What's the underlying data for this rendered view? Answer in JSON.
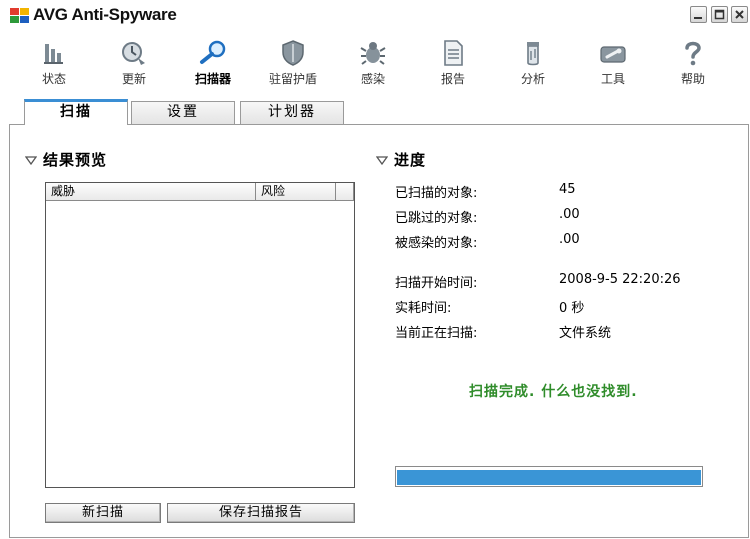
{
  "window": {
    "title": "AVG Anti-Spyware",
    "controls": [
      "minimize-icon",
      "maximize-icon",
      "close-icon"
    ]
  },
  "toolbar": [
    {
      "label": "状态",
      "icon": "status-bars-icon"
    },
    {
      "label": "更新",
      "icon": "update-clock-icon"
    },
    {
      "label": "扫描器",
      "icon": "scanner-magnifier-icon",
      "active": true
    },
    {
      "label": "驻留护盾",
      "icon": "shield-icon"
    },
    {
      "label": "感染",
      "icon": "bug-icon"
    },
    {
      "label": "报告",
      "icon": "report-document-icon"
    },
    {
      "label": "分析",
      "icon": "analysis-jar-icon"
    },
    {
      "label": "工具",
      "icon": "tools-wrench-icon"
    },
    {
      "label": "帮助",
      "icon": "help-question-icon"
    }
  ],
  "tabs": [
    {
      "label": "扫描",
      "active": true
    },
    {
      "label": "设置"
    },
    {
      "label": "计划器"
    }
  ],
  "results": {
    "title": "结果预览",
    "columns": [
      "威胁",
      "风险"
    ]
  },
  "buttons": {
    "new_scan": "新扫描",
    "save_report": "保存扫描报告"
  },
  "progress": {
    "title": "进度",
    "scanned_label": "已扫描的对象:",
    "scanned_value": "45",
    "skipped_label": "已跳过的对象:",
    "skipped_value": ".00",
    "infected_label": "被感染的对象:",
    "infected_value": ".00",
    "start_label": "扫描开始时间:",
    "start_value": "2008-9-5 22:20:26",
    "elapsed_label": "实耗时间:",
    "elapsed_value": "0 秒",
    "current_label": "当前正在扫描:",
    "current_value": "文件系统",
    "status": "扫描完成. 什么也没找到.",
    "percent": 100
  },
  "colors": {
    "accent": "#3a8ed4",
    "success": "#2f8c2a",
    "progress": "#3a95d6"
  }
}
